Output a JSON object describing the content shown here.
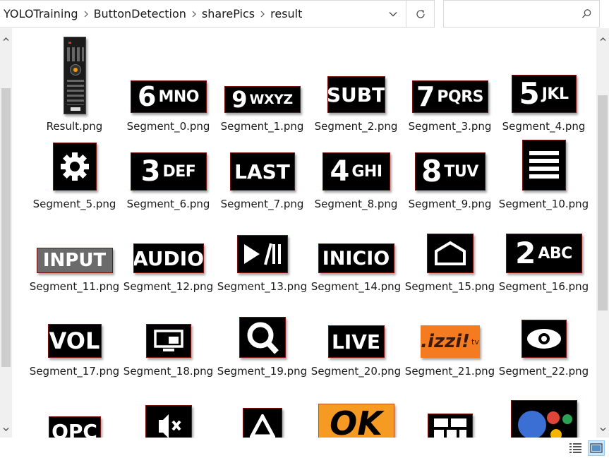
{
  "address_bar": {
    "breadcrumbs": [
      "YOLOTraining",
      "ButtonDetection",
      "sharePics",
      "result"
    ],
    "search_placeholder": ""
  },
  "files": [
    {
      "name": "Result.png",
      "thumb": "remote-control-thumbnail"
    },
    {
      "name": "Segment_0.png",
      "thumb_big": "6",
      "thumb_small": "MNO"
    },
    {
      "name": "Segment_1.png",
      "thumb_big": "9",
      "thumb_small": "WXYZ"
    },
    {
      "name": "Segment_2.png",
      "thumb_text": "SUBT"
    },
    {
      "name": "Segment_3.png",
      "thumb_big": "7",
      "thumb_small": "PQRS"
    },
    {
      "name": "Segment_4.png",
      "thumb_big": "5",
      "thumb_small": "JKL"
    },
    {
      "name": "Segment_5.png",
      "thumb": "gear-icon"
    },
    {
      "name": "Segment_6.png",
      "thumb_big": "3",
      "thumb_small": "DEF"
    },
    {
      "name": "Segment_7.png",
      "thumb_text": "LAST"
    },
    {
      "name": "Segment_8.png",
      "thumb_big": "4",
      "thumb_small": "GHI"
    },
    {
      "name": "Segment_9.png",
      "thumb_big": "8",
      "thumb_small": "TUV"
    },
    {
      "name": "Segment_10.png",
      "thumb": "menu-lines-icon"
    },
    {
      "name": "Segment_11.png",
      "thumb_text": "INPUT"
    },
    {
      "name": "Segment_12.png",
      "thumb_text": "AUDIO"
    },
    {
      "name": "Segment_13.png",
      "thumb": "play-pause-icon"
    },
    {
      "name": "Segment_14.png",
      "thumb_text": "INICIO"
    },
    {
      "name": "Segment_15.png",
      "thumb": "home-outline-icon"
    },
    {
      "name": "Segment_16.png",
      "thumb_big": "2",
      "thumb_small": "ABC"
    },
    {
      "name": "Segment_17.png",
      "thumb_text": "VOL"
    },
    {
      "name": "Segment_18.png",
      "thumb": "screen-mirror-icon"
    },
    {
      "name": "Segment_19.png",
      "thumb": "magnifier-icon"
    },
    {
      "name": "Segment_20.png",
      "thumb_text": "LIVE"
    },
    {
      "name": "Segment_21.png",
      "thumb_text": ".izzi!",
      "thumb_small": "tv"
    },
    {
      "name": "Segment_22.png",
      "thumb": "eye-icon"
    },
    {
      "name": "",
      "thumb_text": "OPC"
    },
    {
      "name": "",
      "thumb": "mute-icon"
    },
    {
      "name": "",
      "thumb": "up-triangle-icon"
    },
    {
      "name": "",
      "thumb_text": "OK"
    },
    {
      "name": "",
      "thumb": "grid-icon"
    },
    {
      "name": "",
      "thumb": "assistant-dots-icon"
    }
  ],
  "colors": {
    "selection_blue": "#cce8ff",
    "thumb_border": "#7a1010",
    "izzi_orange": "#f47b20",
    "ok_orange": "#f59a23"
  }
}
